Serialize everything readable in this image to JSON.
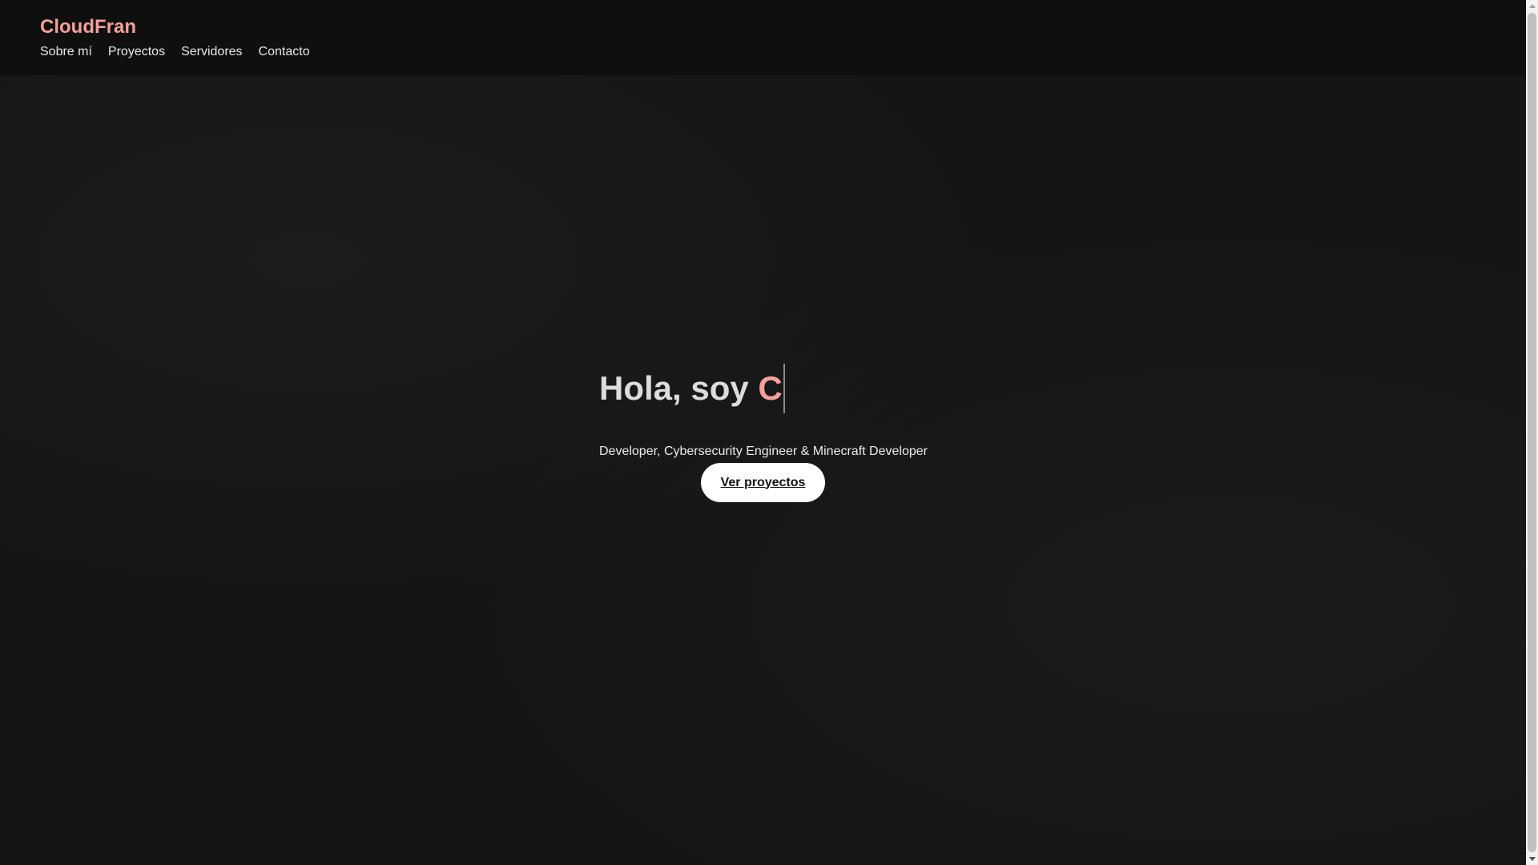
{
  "header": {
    "brand": "CloudFran",
    "nav": [
      {
        "label": "Sobre mí"
      },
      {
        "label": "Proyectos"
      },
      {
        "label": "Servidores"
      },
      {
        "label": "Contacto"
      }
    ]
  },
  "hero": {
    "greeting": "Hola, soy ",
    "typed_name": "C",
    "subtitle": "Developer, Cybersecurity Engineer & Minecraft Developer",
    "cta_label": "Ver proyectos"
  },
  "colors": {
    "accent": "#f5a09a",
    "background": "#151515",
    "header_bg": "#0f0f0f",
    "button_bg": "#ffffff"
  },
  "scrollbar": {
    "scroll_fraction": 0.0
  }
}
